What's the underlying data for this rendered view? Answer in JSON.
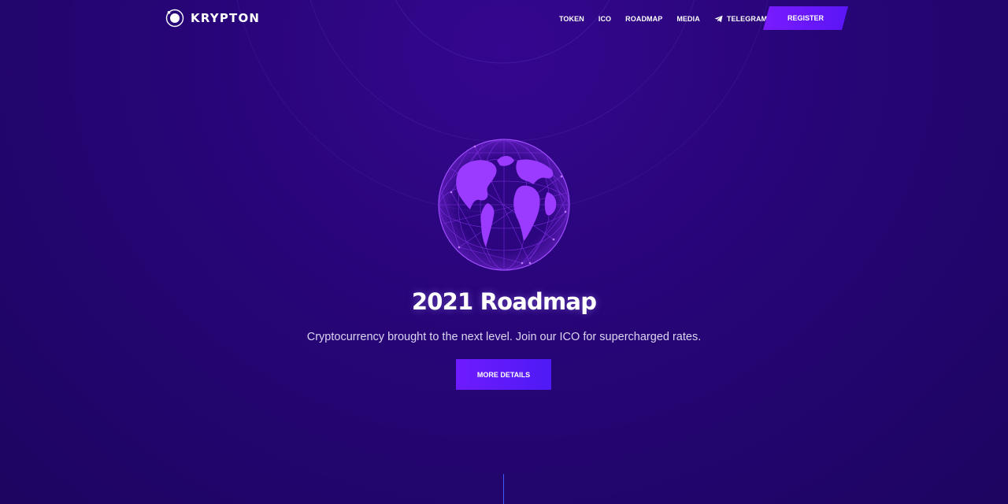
{
  "brand": {
    "name": "KRYPTON",
    "logo_icon": "orbit-logo-icon"
  },
  "nav": {
    "links": [
      {
        "label": "TOKEN"
      },
      {
        "label": "ICO"
      },
      {
        "label": "ROADMAP"
      },
      {
        "label": "MEDIA"
      },
      {
        "label": "TELEGRAM",
        "icon": "telegram-icon"
      }
    ],
    "register_label": "REGISTER"
  },
  "hero": {
    "illustration": "globe-network-icon",
    "title": "2021 Roadmap",
    "subtitle": "Cryptocurrency brought to the next level. Join our ICO for supercharged rates.",
    "cta_label": "MORE DETAILS"
  },
  "colors": {
    "background": "#270577",
    "accent": "#7a1bff",
    "globe": "#9b3bff",
    "scroll_line": "#3d5bff"
  }
}
